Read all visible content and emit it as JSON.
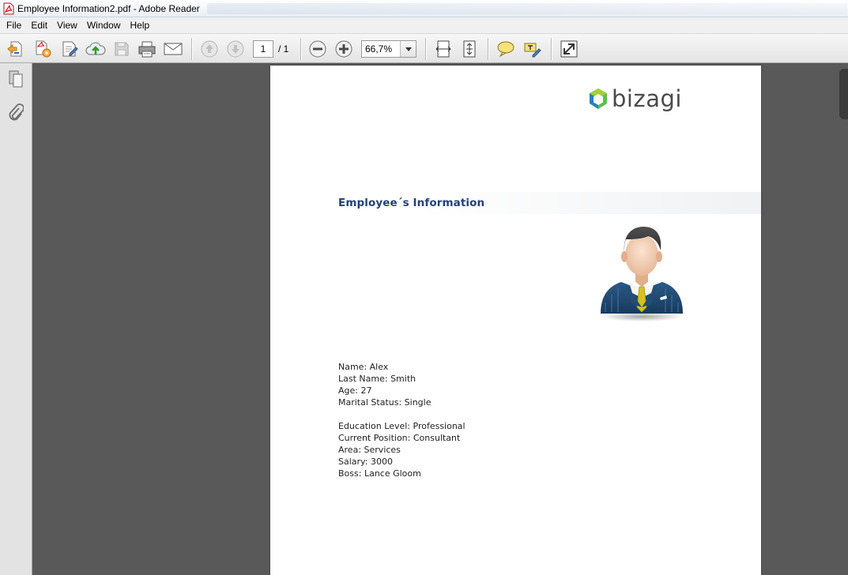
{
  "window": {
    "title": "Employee Information2.pdf - Adobe Reader"
  },
  "menu": [
    "File",
    "Edit",
    "View",
    "Window",
    "Help"
  ],
  "toolbar": {
    "page_current": "1",
    "page_total": "/ 1",
    "zoom": "66,7%"
  },
  "document": {
    "logo_text": "bizagi",
    "heading": "Employee´s Information",
    "fields": [
      {
        "label": "Name",
        "value": "Alex"
      },
      {
        "label": "Last Name",
        "value": "Smith"
      },
      {
        "label": "Age",
        "value": "27"
      },
      {
        "label": "Marital Status",
        "value": "Single"
      },
      {
        "label": "Education Level",
        "value": "Professional"
      },
      {
        "label": "Current Position",
        "value": "Consultant"
      },
      {
        "label": "Area",
        "value": "Services"
      },
      {
        "label": "Salary",
        "value": "3000"
      },
      {
        "label": "Boss",
        "value": "Lance Gloom"
      }
    ]
  },
  "icons": {
    "toolbar": [
      "create-pdf-icon",
      "combine-files-icon",
      "edit-document-icon",
      "upload-cloud-icon",
      "save-icon",
      "print-icon",
      "email-icon",
      "previous-page-icon",
      "next-page-icon",
      "zoom-out-icon",
      "zoom-in-icon",
      "fit-width-icon",
      "fit-page-icon",
      "comment-icon",
      "highlight-icon",
      "full-screen-icon"
    ],
    "sidebar": [
      "pages-icon",
      "attachment-icon"
    ]
  },
  "colors": {
    "heading": "#23407a",
    "viewer_background": "#595959"
  }
}
